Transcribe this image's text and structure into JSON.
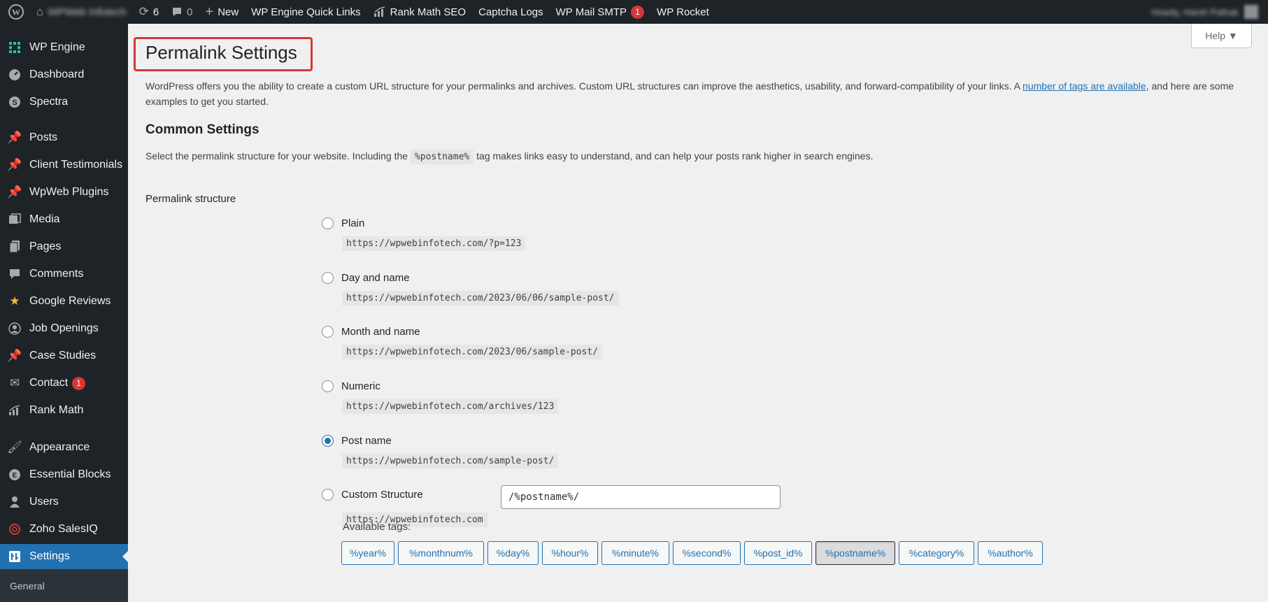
{
  "adminbar": {
    "site_name": "WPWeb Infotech",
    "updates_count": "6",
    "comments_count": "0",
    "new_label": "New",
    "items": [
      {
        "label": "WP Engine Quick Links",
        "icon": "wp-engine-icon"
      },
      {
        "label": "Rank Math SEO",
        "icon": "rank-math-icon"
      },
      {
        "label": "Captcha Logs",
        "icon": ""
      },
      {
        "label": "WP Mail SMTP",
        "icon": "",
        "badge": "1"
      },
      {
        "label": "WP Rocket",
        "icon": ""
      }
    ],
    "howdy": "Howdy, Harsh Pathak"
  },
  "sidebar": {
    "items": [
      {
        "label": "WP Engine",
        "icon": "grid-icon"
      },
      {
        "label": "Dashboard",
        "icon": "dashboard-icon"
      },
      {
        "label": "Spectra",
        "icon": "spectra-icon"
      },
      {
        "label": "Posts",
        "icon": "pin-icon"
      },
      {
        "label": "Client Testimonials",
        "icon": "pin-icon"
      },
      {
        "label": "WpWeb Plugins",
        "icon": "pin-icon"
      },
      {
        "label": "Media",
        "icon": "media-icon"
      },
      {
        "label": "Pages",
        "icon": "pages-icon"
      },
      {
        "label": "Comments",
        "icon": "comment-icon"
      },
      {
        "label": "Google Reviews",
        "icon": "star-icon"
      },
      {
        "label": "Job Openings",
        "icon": "person-icon"
      },
      {
        "label": "Case Studies",
        "icon": "pin-icon"
      },
      {
        "label": "Contact",
        "icon": "mail-icon",
        "badge": "1"
      },
      {
        "label": "Rank Math",
        "icon": "rank-math-icon"
      },
      {
        "label": "Appearance",
        "icon": "brush-icon"
      },
      {
        "label": "Essential Blocks",
        "icon": "blocks-icon"
      },
      {
        "label": "Users",
        "icon": "users-icon"
      },
      {
        "label": "Zoho SalesIQ",
        "icon": "zoho-icon"
      },
      {
        "label": "Settings",
        "icon": "settings-icon"
      }
    ],
    "submenu_general": "General"
  },
  "help": {
    "label": "Help ▼"
  },
  "page": {
    "title": "Permalink Settings",
    "intro_before_link": "WordPress offers you the ability to create a custom URL structure for your permalinks and archives. Custom URL structures can improve the aesthetics, usability, and forward-compatibility of your links. A ",
    "intro_link": "number of tags are available",
    "intro_after_link": ", and here are some examples to get you started.",
    "common_heading": "Common Settings",
    "common_desc_before": "Select the permalink structure for your website. Including the",
    "common_desc_code": "%postname%",
    "common_desc_after": "tag makes links easy to understand, and can help your posts rank higher in search engines.",
    "structure_label": "Permalink structure"
  },
  "options": [
    {
      "label": "Plain",
      "example": "https://wpwebinfotech.com/?p=123",
      "checked": false
    },
    {
      "label": "Day and name",
      "example": "https://wpwebinfotech.com/2023/06/06/sample-post/",
      "checked": false
    },
    {
      "label": "Month and name",
      "example": "https://wpwebinfotech.com/2023/06/sample-post/",
      "checked": false
    },
    {
      "label": "Numeric",
      "example": "https://wpwebinfotech.com/archives/123",
      "checked": false
    },
    {
      "label": "Post name",
      "example": "https://wpwebinfotech.com/sample-post/",
      "checked": true
    },
    {
      "label": "Custom Structure",
      "example": "https://wpwebinfotech.com",
      "checked": false
    }
  ],
  "custom": {
    "value": "/%postname%/",
    "available_tags_label": "Available tags:",
    "tags": [
      "%year%",
      "%monthnum%",
      "%day%",
      "%hour%",
      "%minute%",
      "%second%",
      "%post_id%",
      "%postname%",
      "%category%",
      "%author%"
    ],
    "active_tag": "%postname%"
  },
  "colors": {
    "accent": "#2271b1",
    "highlight_border": "#d63638",
    "sidebar_bg": "#1d2327"
  }
}
